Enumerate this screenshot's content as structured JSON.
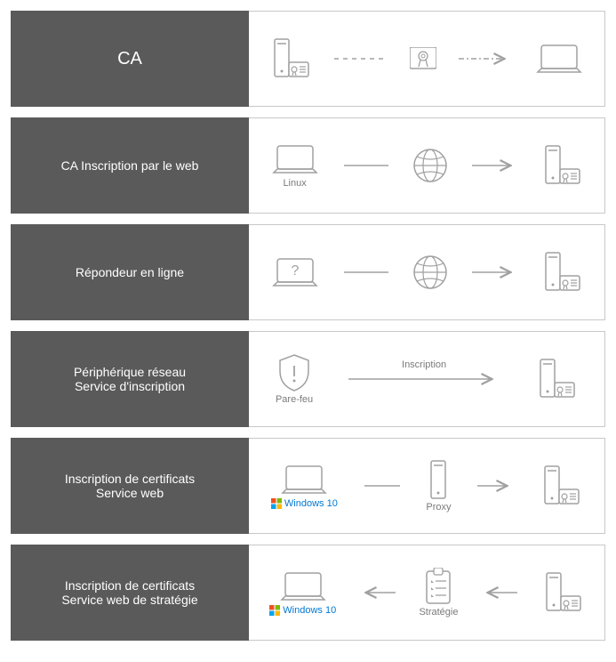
{
  "rows": [
    {
      "id": "ca",
      "title_lines": [
        "CA"
      ]
    },
    {
      "id": "ca-web",
      "title_lines": [
        "CA Inscription par le web"
      ]
    },
    {
      "id": "online-responder",
      "title_lines": [
        "Répondeur en ligne"
      ]
    },
    {
      "id": "ndes",
      "title_lines": [
        "Périphérique réseau",
        "Service d'inscription"
      ]
    },
    {
      "id": "ces",
      "title_lines": [
        "Inscription de certificats",
        "Service web"
      ]
    },
    {
      "id": "cep",
      "title_lines": [
        "Inscription de certificats",
        "Service web de stratégie"
      ]
    }
  ],
  "captions": {
    "linux": "Linux",
    "firewall": "Pare-feu",
    "enrollment": "Inscription",
    "windows10": "Windows 10",
    "proxy": "Proxy",
    "strategy": "Stratégie"
  },
  "colors": {
    "label_bg": "#5a5a5a",
    "stroke": "#a0a0a0",
    "win_blue": "#0078d4"
  },
  "chart_data": {
    "type": "table",
    "title": "AD CS role services diagram",
    "rows": [
      {
        "service": "CA",
        "flow": "Server+certificate --(dashed)--> certificate badge --(dash-dot)--> laptop"
      },
      {
        "service": "CA Inscription par le web",
        "flow": "Laptop (Linux) --line--> globe --arrow--> server+certificate"
      },
      {
        "service": "Répondeur en ligne",
        "flow": "Laptop with '?' --line--> globe --arrow--> server+certificate"
      },
      {
        "service": "Périphérique réseau Service d'inscription",
        "flow": "Shield (Pare-feu) --arrow (Inscription)--> server+certificate"
      },
      {
        "service": "Inscription de certificats Service web",
        "flow": "Laptop (Windows 10) --line--> server (Proxy) --arrow--> server+certificate"
      },
      {
        "service": "Inscription de certificats Service web de stratégie",
        "flow": "Laptop (Windows 10) <--arrow-- clipboard (Stratégie) <--arrow-- server+certificate"
      }
    ]
  }
}
